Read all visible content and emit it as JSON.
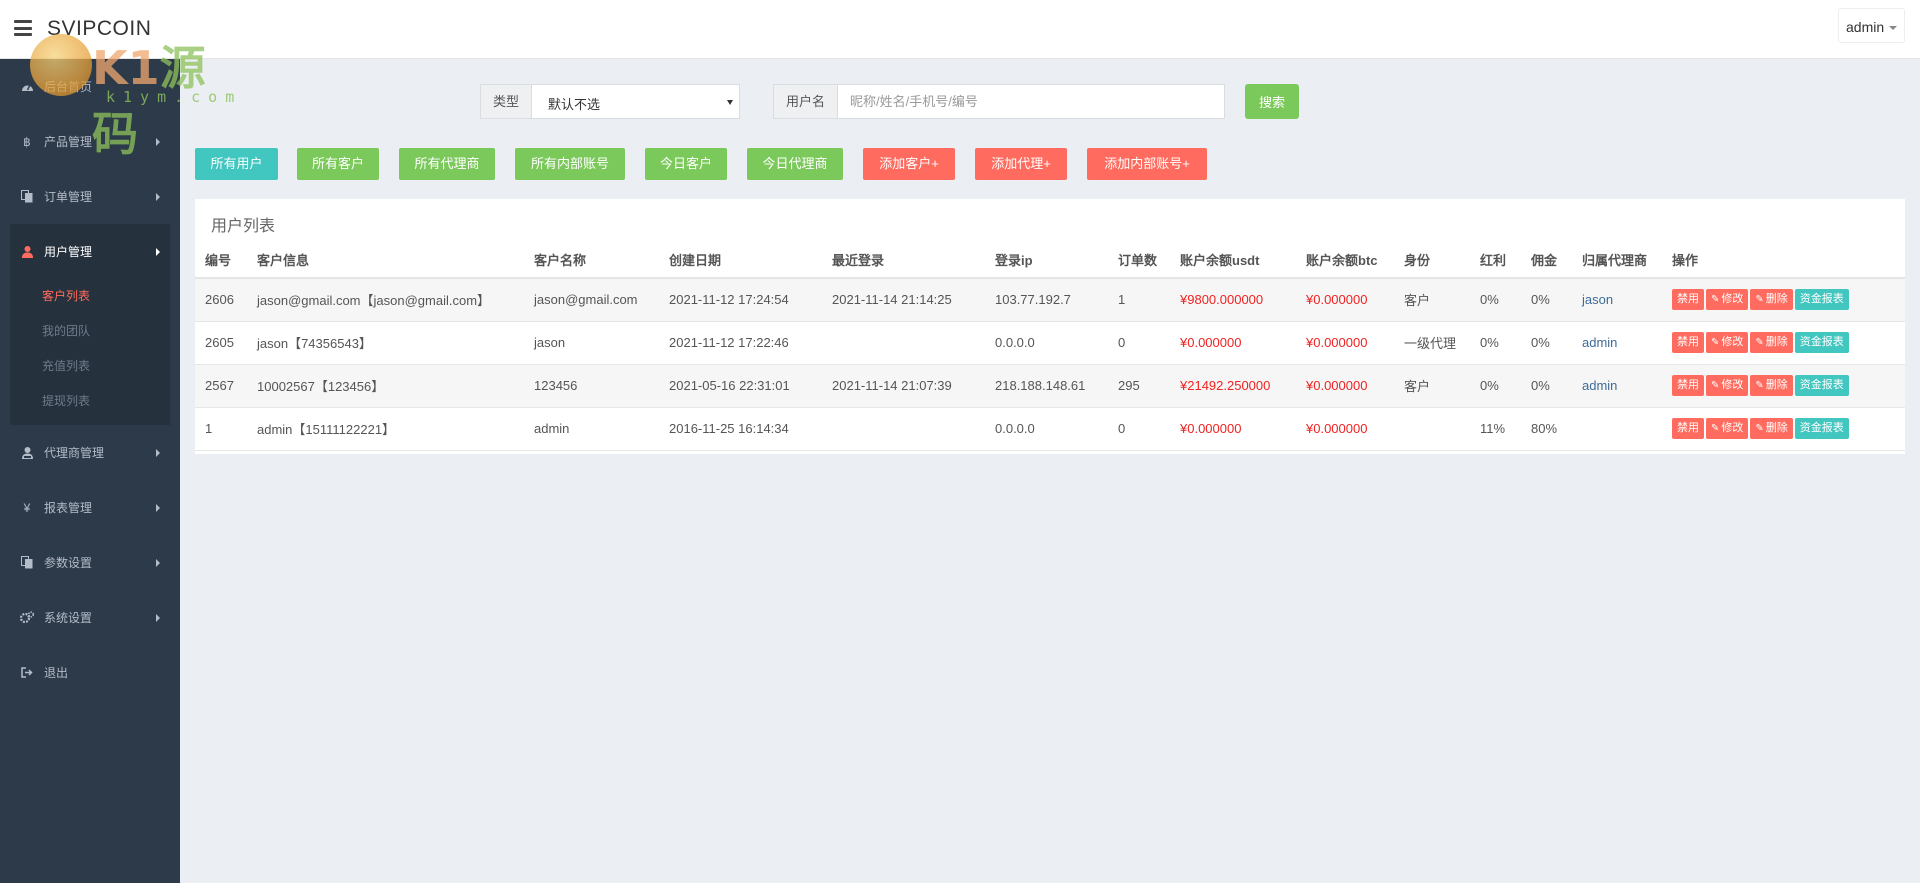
{
  "header": {
    "brand": "SVIPCOIN",
    "user_menu": "admin"
  },
  "watermark": {
    "main": "K1",
    "accent": "源码",
    "url": "k1ym.com"
  },
  "sidebar": {
    "items": [
      {
        "label": "后台首页",
        "icon": "dashboard-icon"
      },
      {
        "label": "产品管理",
        "icon": "bitcoin-icon"
      },
      {
        "label": "订单管理",
        "icon": "copy-icon"
      },
      {
        "label": "用户管理",
        "icon": "user-icon"
      },
      {
        "label": "代理商管理",
        "icon": "user-tie-icon"
      },
      {
        "label": "报表管理",
        "icon": "yen-icon"
      },
      {
        "label": "参数设置",
        "icon": "copy-icon"
      },
      {
        "label": "系统设置",
        "icon": "cogs-icon"
      },
      {
        "label": "退出",
        "icon": "sign-out-icon"
      }
    ],
    "sub_items": [
      "客户列表",
      "我的团队",
      "充值列表",
      "提现列表"
    ]
  },
  "search": {
    "type_label": "类型",
    "type_value": "默认不选",
    "name_label": "用户名",
    "name_placeholder": "昵称/姓名/手机号/编号",
    "button": "搜索"
  },
  "filters": [
    "所有用户",
    "所有客户",
    "所有代理商",
    "所有内部账号",
    "今日客户",
    "今日代理商",
    "添加客户+",
    "添加代理+",
    "添加内部账号+"
  ],
  "panel": {
    "title": "用户列表",
    "columns": [
      "编号",
      "客户信息",
      "客户名称",
      "创建日期",
      "最近登录",
      "登录ip",
      "订单数",
      "账户余额usdt",
      "账户余额btc",
      "身份",
      "红利",
      "佣金",
      "归属代理商",
      "操作"
    ],
    "rows": [
      [
        "2606",
        "jason@gmail.com【jason@gmail.com】",
        "jason@gmail.com",
        "2021-11-12 17:24:54",
        "2021-11-14 21:14:25",
        "103.77.192.7",
        "1",
        "¥9800.000000",
        "¥0.000000",
        "客户",
        "0%",
        "0%",
        "jason"
      ],
      [
        "2605",
        "jason【74356543】",
        "jason",
        "2021-11-12 17:22:46",
        "",
        "0.0.0.0",
        "0",
        "¥0.000000",
        "¥0.000000",
        "一级代理",
        "0%",
        "0%",
        "admin"
      ],
      [
        "2567",
        "10002567【123456】",
        "123456",
        "2021-05-16 22:31:01",
        "2021-11-14 21:07:39",
        "218.188.148.61",
        "295",
        "¥21492.250000",
        "¥0.000000",
        "客户",
        "0%",
        "0%",
        "admin"
      ],
      [
        "1",
        "admin【15111122221】",
        "admin",
        "2016-11-25 16:14:34",
        "",
        "0.0.0.0",
        "0",
        "¥0.000000",
        "¥0.000000",
        "",
        "11%",
        "80%",
        ""
      ]
    ],
    "actions": {
      "disable": "禁用",
      "edit": "修改",
      "delete": "删除",
      "report": "资金报表"
    }
  },
  "colors": {
    "teal": "#41c6c0",
    "green": "#7cc95b",
    "red": "#ff6b5e",
    "sidebar": "#2d3a4a"
  }
}
